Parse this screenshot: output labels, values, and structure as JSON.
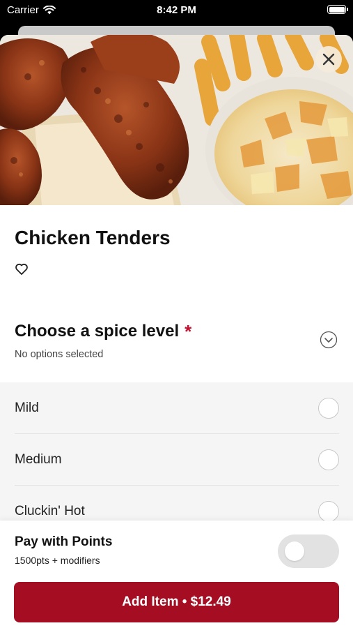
{
  "status_bar": {
    "carrier": "Carrier",
    "time": "8:42 PM",
    "icons": [
      "wifi-icon",
      "battery-icon"
    ]
  },
  "item": {
    "title": "Chicken Tenders",
    "hero_icon": "food-photo",
    "close_icon": "close-icon",
    "favorite_icon": "heart-icon"
  },
  "spice_section": {
    "title": "Choose a spice level",
    "required_mark": "*",
    "subtitle": "No options selected",
    "expand_icon": "chevron-down-icon",
    "options": [
      {
        "label": "Mild",
        "selected": false
      },
      {
        "label": "Medium",
        "selected": false
      },
      {
        "label": "Cluckin' Hot",
        "selected": false
      }
    ]
  },
  "points": {
    "title": "Pay with Points",
    "subtitle": "1500pts + modifiers",
    "toggle_on": false
  },
  "cta": {
    "label": "Add Item • $12.49"
  },
  "colors": {
    "accent": "#a50e22",
    "required": "#c8102e"
  }
}
